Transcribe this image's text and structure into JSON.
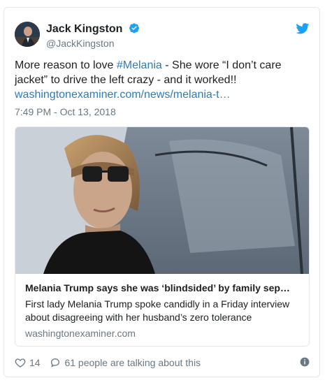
{
  "author": {
    "display_name": "Jack Kingston",
    "handle": "@JackKingston"
  },
  "tweet": {
    "text_prefix": "More reason to love ",
    "hashtag": "#Melania",
    "text_suffix": " - She wore “I don’t care jacket” to drive the left crazy - and it worked!!",
    "url": "washingtonexaminer.com/news/melania-t…",
    "timestamp": "7:49 PM - Oct 13, 2018"
  },
  "card": {
    "title": "Melania Trump says she was ‘blindsided’ by family sep…",
    "description": "First lady Melania Trump spoke candidly in a Friday interview about disagreeing with her husband’s zero tolerance",
    "domain": "washingtonexaminer.com"
  },
  "footer": {
    "likes": "14",
    "conversation": "61 people are talking about this"
  },
  "colors": {
    "link": "#2b7bb9",
    "verified": "#1da1f2",
    "muted": "#697882"
  },
  "icons": [
    "verified-badge-icon",
    "twitter-bird-icon",
    "heart-icon",
    "reply-bubble-icon",
    "info-icon"
  ]
}
